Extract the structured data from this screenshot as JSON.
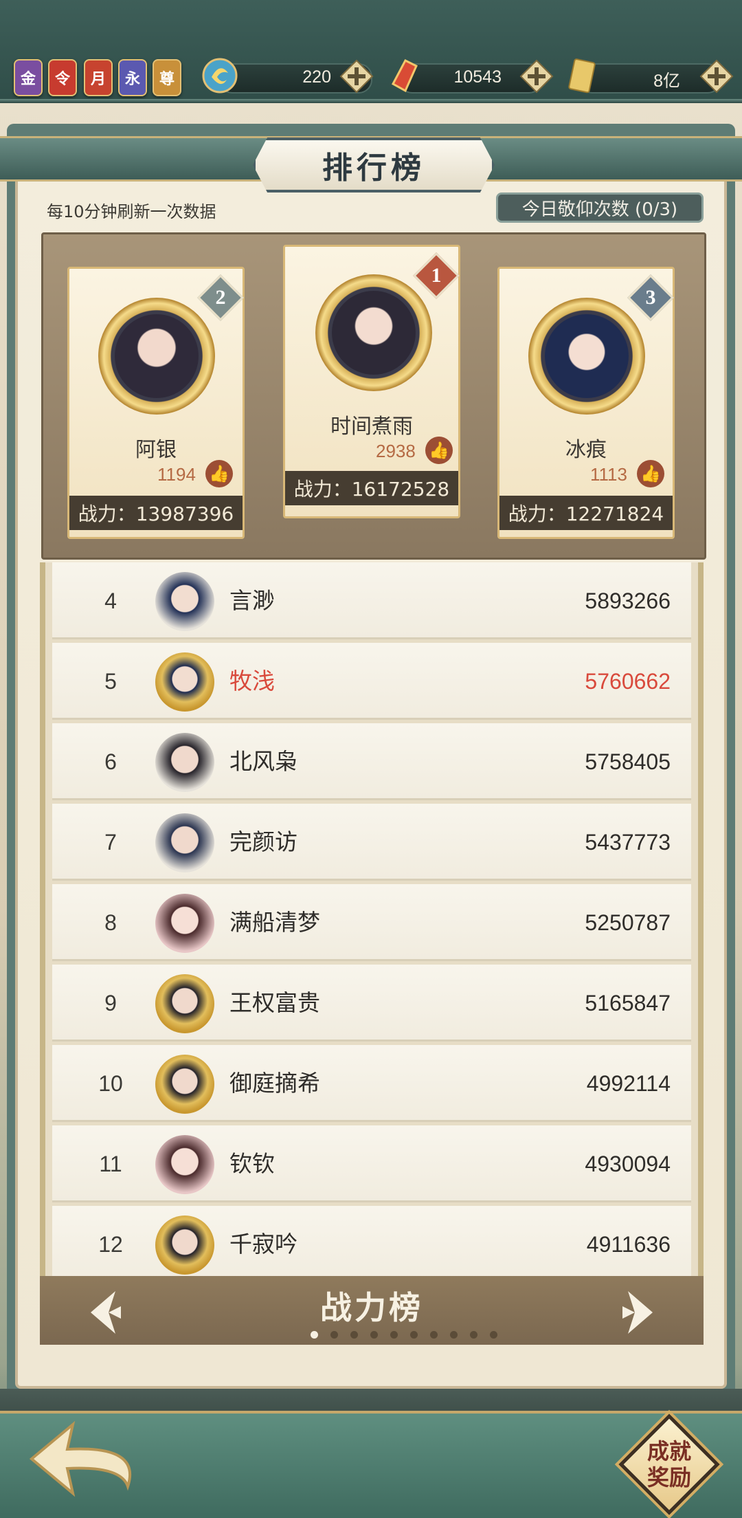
{
  "title": "排行榜",
  "refresh_note": "每10分钟刷新一次数据",
  "worship_button": "今日敬仰次数 (0/3)",
  "vip_badges": [
    {
      "label": "金",
      "color": "#7a4ea0"
    },
    {
      "label": "令",
      "color": "#c73b2f"
    },
    {
      "label": "月",
      "color": "#c7432f"
    },
    {
      "label": "永",
      "color": "#5b59b0"
    },
    {
      "label": "尊",
      "color": "#c8903a"
    }
  ],
  "resources": [
    {
      "icon": "jade-coin-icon",
      "value": "220"
    },
    {
      "icon": "red-gem-icon",
      "value": "10543"
    },
    {
      "icon": "gold-ticket-icon",
      "value": "8亿"
    }
  ],
  "podium": [
    {
      "rank": "2",
      "name": "阿银",
      "likes": "1194",
      "power": "战力：13987396"
    },
    {
      "rank": "1",
      "name": "时间煮雨",
      "likes": "2938",
      "power": "战力：16172528"
    },
    {
      "rank": "3",
      "name": "冰痕",
      "likes": "1113",
      "power": "战力：12271824"
    }
  ],
  "list": [
    {
      "rank": "4",
      "name": "言渺",
      "power": "5893266"
    },
    {
      "rank": "5",
      "name": "牧浅",
      "power": "5760662"
    },
    {
      "rank": "6",
      "name": "北风枭",
      "power": "5758405"
    },
    {
      "rank": "7",
      "name": "完颜访",
      "power": "5437773"
    },
    {
      "rank": "8",
      "name": "满船清梦",
      "power": "5250787"
    },
    {
      "rank": "9",
      "name": "王权富贵",
      "power": "5165847"
    },
    {
      "rank": "10",
      "name": "御庭摘希",
      "power": "4992114"
    },
    {
      "rank": "11",
      "name": "钦钦",
      "power": "4930094"
    },
    {
      "rank": "12",
      "name": "千寂吟",
      "power": "4911636"
    }
  ],
  "board_name": "战力榜",
  "page_dots": {
    "total": 10,
    "active": 0
  },
  "achievement_button": "成就\n奖励",
  "colors": {
    "highlight": "#d94a3c",
    "accent": "#c6a86a"
  }
}
